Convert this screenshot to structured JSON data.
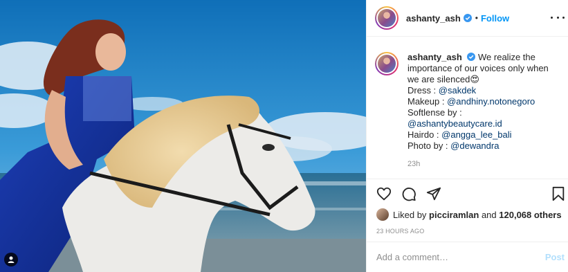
{
  "post": {
    "username": "ashanty_ash",
    "dot": "•",
    "follow_label": "Follow",
    "caption": {
      "username": "ashanty_ash",
      "lines": [
        "We realize the",
        "importance of our voices only when",
        "we are silenced😍"
      ],
      "credits": [
        {
          "label": "Dress : ",
          "mention": "@sakdek"
        },
        {
          "label": "Makeup : ",
          "mention": "@andhiny.notonegoro"
        },
        {
          "label": "Softlense by :",
          "mention": ""
        },
        {
          "label": "",
          "mention": "@ashantybeautycare.id"
        },
        {
          "label": "Hairdo : ",
          "mention": "@angga_lee_bali"
        },
        {
          "label": "Photo by : ",
          "mention": "@dewandra"
        }
      ],
      "age": "23h"
    },
    "likes": {
      "prefix": "Liked by ",
      "liker": "picciramlan",
      "middle": " and ",
      "count": "120,068 others"
    },
    "timestamp": "23 HOURS AGO",
    "comment_placeholder": "Add a comment…",
    "post_label": "Post"
  },
  "icons": {
    "verified": "verified-badge-icon",
    "more": "more-options-icon",
    "like": "heart-icon",
    "comment": "comment-icon",
    "share": "paper-plane-icon",
    "save": "bookmark-icon",
    "tagged": "user-tag-icon"
  },
  "colors": {
    "accent": "#0095f6",
    "mention": "#00376b",
    "muted": "#8e8e8e",
    "post_disabled": "#b2dffc"
  }
}
